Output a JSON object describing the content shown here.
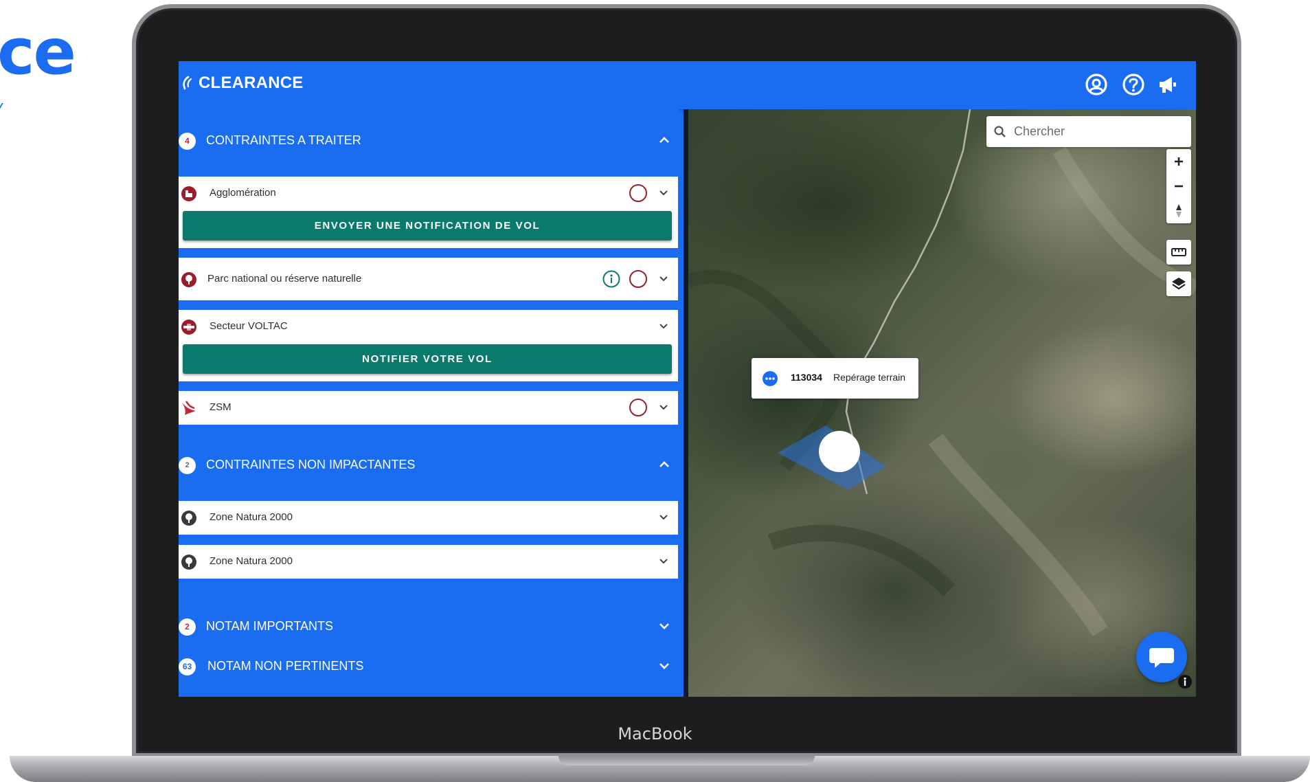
{
  "backdrop": {
    "heading_fragment": "ce",
    "device_label": "MacBook"
  },
  "app": {
    "title": "CLEARANCE",
    "accent_color": "#1a6cf0",
    "action_color": "#0b7a6c",
    "alert_color": "#9b1c2c"
  },
  "header_icons": [
    "account-icon",
    "help-icon",
    "megaphone-icon"
  ],
  "sections": {
    "to_treat": {
      "count": "4",
      "label": "CONTRAINTES A TRAITER",
      "expanded": true
    },
    "non_impacting": {
      "count": "2",
      "label": "CONTRAINTES NON IMPACTANTES",
      "expanded": true
    },
    "notam_important": {
      "count": "2",
      "label": "NOTAM IMPORTANTS",
      "expanded": false
    },
    "notam_irrelevant": {
      "count": "63",
      "label": "NOTAM NON PERTINENTS",
      "expanded": false
    }
  },
  "constraints": {
    "agglomeration": {
      "label": "Agglomération",
      "action": "ENVOYER UNE NOTIFICATION DE VOL"
    },
    "parc": {
      "label": "Parc national ou réserve naturelle"
    },
    "voltac": {
      "label": "Secteur VOLTAC",
      "action": "NOTIFIER VOTRE VOL"
    },
    "zsm": {
      "label": "ZSM"
    },
    "natura1": {
      "label": "Zone Natura 2000"
    },
    "natura2": {
      "label": "Zone Natura 2000"
    }
  },
  "map": {
    "search": {
      "placeholder": "Chercher",
      "value": ""
    },
    "controls": [
      "zoom-in-icon",
      "zoom-out-icon",
      "compass-icon",
      "ruler-icon",
      "layers-icon"
    ],
    "flight": {
      "id": "113034",
      "name": "Repérage terrain"
    }
  }
}
